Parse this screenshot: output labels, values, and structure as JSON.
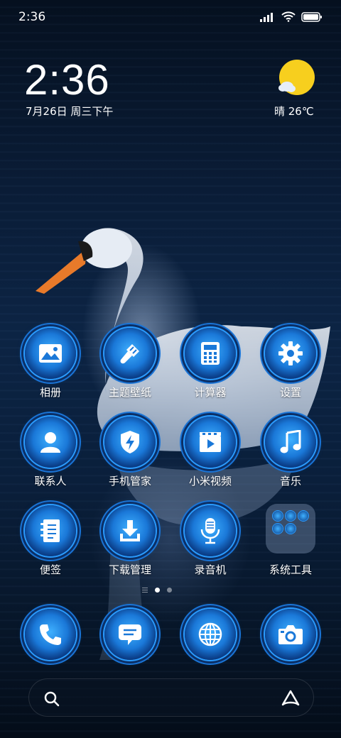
{
  "status_bar": {
    "time": "2:36",
    "icons": [
      "signal-icon",
      "wifi-icon",
      "battery-icon"
    ]
  },
  "clock_widget": {
    "time": "2:36",
    "date": "7月26日 周三下午"
  },
  "weather_widget": {
    "icon": "partly-cloudy-sun-icon",
    "text": "晴 26℃"
  },
  "apps": [
    {
      "label": "相册",
      "icon": "gallery-icon"
    },
    {
      "label": "主题壁纸",
      "icon": "paintbrush-icon"
    },
    {
      "label": "计算器",
      "icon": "calculator-icon"
    },
    {
      "label": "设置",
      "icon": "gear-icon"
    },
    {
      "label": "联系人",
      "icon": "contact-icon"
    },
    {
      "label": "手机管家",
      "icon": "security-shield-icon"
    },
    {
      "label": "小米视频",
      "icon": "video-icon"
    },
    {
      "label": "音乐",
      "icon": "music-note-icon"
    },
    {
      "label": "便签",
      "icon": "notepad-icon"
    },
    {
      "label": "下载管理",
      "icon": "download-icon"
    },
    {
      "label": "录音机",
      "icon": "microphone-icon"
    },
    {
      "label": "系统工具",
      "icon": "folder-icon"
    }
  ],
  "dock": [
    {
      "icon": "phone-icon"
    },
    {
      "icon": "message-icon"
    },
    {
      "icon": "browser-globe-icon"
    },
    {
      "icon": "camera-icon"
    }
  ],
  "search_bar": {
    "left_icon": "search-icon",
    "right_icon": "assistant-icon"
  },
  "colors": {
    "accent_blue": "#1a78d8",
    "sun_yellow": "#f7cf1e"
  }
}
